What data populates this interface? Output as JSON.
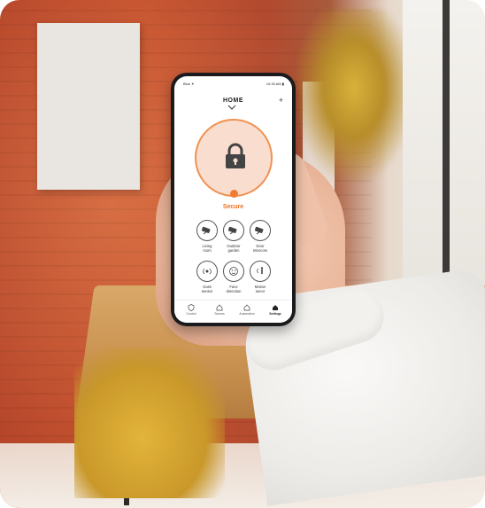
{
  "status_bar": {
    "left": "Blue ✦",
    "right": "10:30 AM ▮"
  },
  "app": {
    "title": "HOME",
    "status_label": "Secure",
    "accent_color": "#f07c30",
    "lock_icon": "padlock-icon"
  },
  "tiles": [
    {
      "label_line1": "Living",
      "label_line2": "room",
      "icon": "camera-icon"
    },
    {
      "label_line1": "Outdoor",
      "label_line2": "garden",
      "icon": "camera-icon"
    },
    {
      "label_line1": "Door",
      "label_line2": "Intercom",
      "icon": "camera-icon"
    },
    {
      "label_line1": "Gass",
      "label_line2": "sensor",
      "icon": "gas-sensor-icon"
    },
    {
      "label_line1": "Face",
      "label_line2": "detection",
      "icon": "face-icon"
    },
    {
      "label_line1": "Motion",
      "label_line2": "senor",
      "icon": "motion-icon"
    }
  ],
  "tabs": [
    {
      "label": "Control",
      "icon": "shield-icon"
    },
    {
      "label": "Scenes",
      "icon": "house-icon"
    },
    {
      "label": "Automation",
      "icon": "house-icon"
    },
    {
      "label": "Settings",
      "icon": "house-filled-icon",
      "active": true
    }
  ]
}
